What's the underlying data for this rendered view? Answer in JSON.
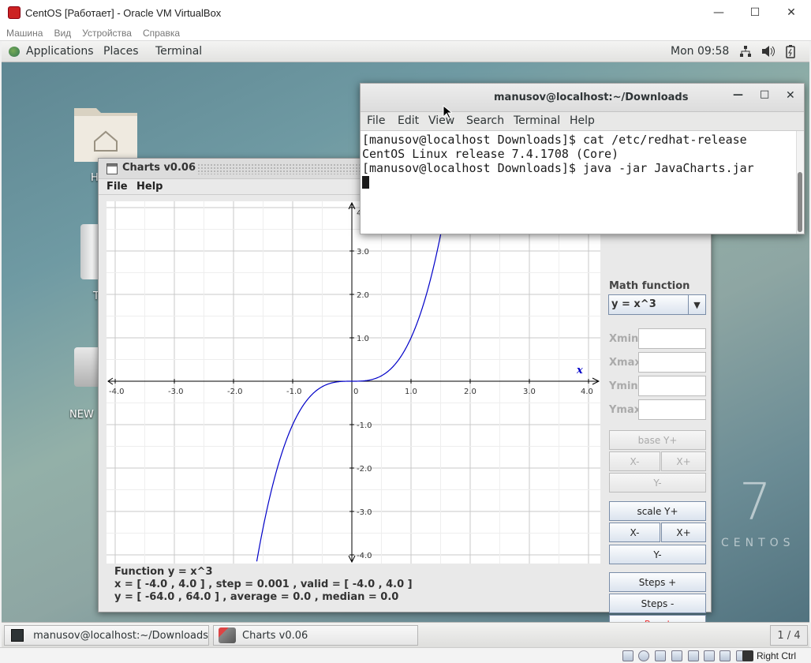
{
  "vbox": {
    "title": "CentOS [Работает] - Oracle VM VirtualBox",
    "menu": [
      "Машина",
      "Вид",
      "Устройства",
      "Справка"
    ],
    "status_host_key": "Right Ctrl"
  },
  "gnome": {
    "applications": "Applications",
    "places": "Places",
    "terminal": "Terminal",
    "clock": "Mon 09:58"
  },
  "desktop": {
    "folder_label": "H",
    "trash_label": "T",
    "disk_label": "NEW",
    "brand_number": "7",
    "brand_text": "CENTOS"
  },
  "terminal_window": {
    "title": "manusov@localhost:~/Downloads",
    "menu": [
      "File",
      "Edit",
      "View",
      "Search",
      "Terminal",
      "Help"
    ],
    "lines": [
      "[manusov@localhost Downloads]$ cat /etc/redhat-release",
      "CentOS Linux release 7.4.1708 (Core)",
      "[manusov@localhost Downloads]$ java -jar JavaCharts.jar"
    ]
  },
  "charts_window": {
    "title": "Charts v0.06",
    "menu": [
      "File",
      "Help"
    ],
    "math_function_label": "Math function",
    "math_function_value": "y = x^3",
    "range_labels": [
      "Xmin",
      "Xmax",
      "Ymin",
      "Ymax"
    ],
    "buttons": {
      "base_yplus": "base Y+",
      "base_xminus": "X-",
      "base_xplus": "X+",
      "base_yminus": "Y-",
      "scale_yplus": "scale Y+",
      "scale_xminus": "X-",
      "scale_xplus": "X+",
      "scale_yminus": "Y-",
      "steps_plus": "Steps +",
      "steps_minus": "Steps -",
      "reset": "Reset"
    },
    "info": [
      "Function  y = x^3",
      "x = [ -4.0  ,  4.0 ] , step = 0.001 , valid = [ -4.0 , 4.0 ]",
      "y = [ -64.0  ,  64.0 ] , average = 0.0 , median = 0.0"
    ],
    "colors": {
      "curve": "#0000c8",
      "axis": "#000000",
      "grid": "#c8c8c8",
      "reset_text": "#e33333"
    }
  },
  "chart_data": {
    "type": "line",
    "function": "y = x^3",
    "x_range": [
      -4.0,
      4.0
    ],
    "y_range": [
      -4.0,
      4.0
    ],
    "xticks": [
      "-4.0",
      "-3.0",
      "-2.0",
      "-1.0",
      "0",
      "1.0",
      "2.0",
      "3.0",
      "4.0"
    ],
    "yticks": [
      "4",
      "3.0",
      "2.0",
      "1.0",
      "-1.0",
      "-2.0",
      "-3.0",
      "-4.0"
    ],
    "x_axis_marker": "x",
    "grid": true,
    "series": [
      {
        "name": "y = x^3",
        "x": [
          -1.587,
          -1.2,
          -1.0,
          -0.6,
          -0.3,
          0.0,
          0.3,
          0.6,
          1.0,
          1.2,
          1.5
        ],
        "y": [
          -4.0,
          -1.728,
          -1.0,
          -0.216,
          -0.027,
          0.0,
          0.027,
          0.216,
          1.0,
          1.728,
          3.375
        ]
      }
    ]
  },
  "taskbar": {
    "items": [
      "manusov@localhost:~/Downloads",
      "Charts v0.06"
    ],
    "pager": "1 / 4"
  }
}
